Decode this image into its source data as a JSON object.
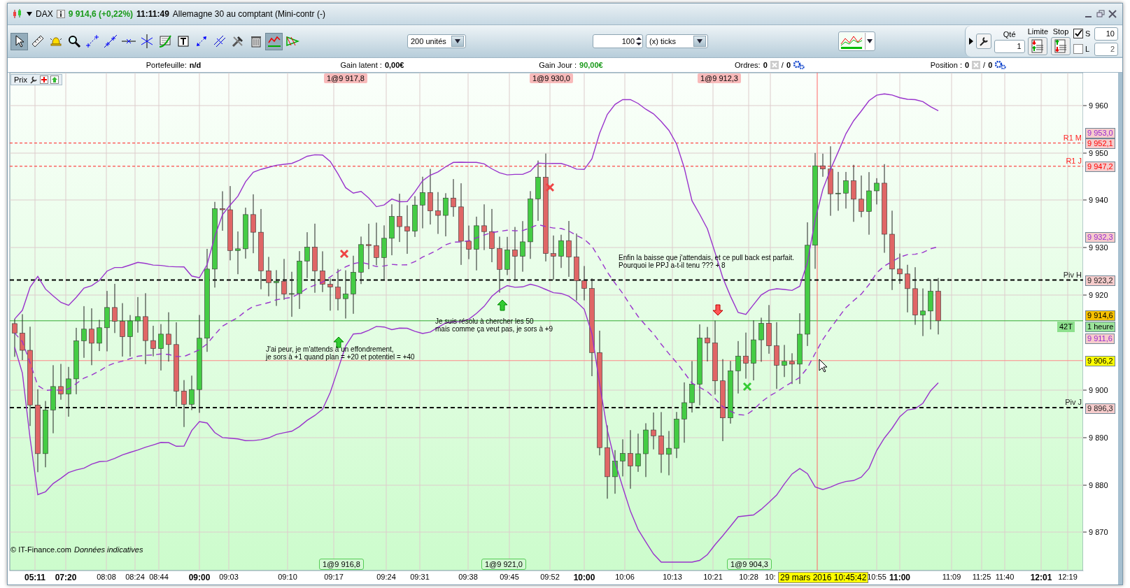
{
  "title_bar": {
    "symbol": "DAX",
    "quote": "9 914,6 (+0,22%)",
    "time": "11:11:49",
    "instrument": "Allemagne 30 au comptant (Mini-contr (-)"
  },
  "toolbar": {
    "tools": [
      {
        "kind": "pointer",
        "selected": true
      },
      {
        "kind": "ruler",
        "selected": false
      },
      {
        "kind": "alarm",
        "selected": false
      },
      {
        "kind": "zoom",
        "selected": false
      },
      {
        "kind": "segment",
        "selected": false
      },
      {
        "kind": "line",
        "selected": false
      },
      {
        "kind": "hline",
        "selected": false
      },
      {
        "kind": "vline",
        "selected": false
      },
      {
        "kind": "indicator",
        "selected": false
      },
      {
        "kind": "text",
        "selected": false
      },
      {
        "kind": "arrows",
        "selected": false
      },
      {
        "kind": "parallel",
        "selected": false
      },
      {
        "kind": "tools",
        "selected": false
      },
      {
        "kind": "trash",
        "selected": false
      },
      {
        "kind": "trend",
        "selected": true
      },
      {
        "kind": "triangle",
        "selected": false
      }
    ],
    "units_select": "200 unités",
    "tick_value": "100",
    "tick_select": "(x) ticks"
  },
  "order_panel": {
    "qty_label": "Qté",
    "qty": "1",
    "limit_label": "Limite",
    "stop_label": "Stop",
    "options": [
      {
        "label": "S",
        "checked": true,
        "value": "10"
      },
      {
        "label": "L",
        "checked": false,
        "value": "2"
      }
    ]
  },
  "info_bar": [
    {
      "kind": "text",
      "label": "Portefeuille:",
      "value": "n/d"
    },
    {
      "kind": "text",
      "label": "Gain latent :",
      "value": "0,00€"
    },
    {
      "kind": "gain",
      "label": "Gain Jour :",
      "value": "90,00€"
    },
    {
      "kind": "count",
      "label": "Ordres:",
      "value": "0",
      "separator": "/",
      "value_2": "0"
    },
    {
      "kind": "count",
      "label": "Position :",
      "value": "0",
      "separator": "/",
      "value_2": "0"
    }
  ],
  "chart": {
    "panel_label": "Prix",
    "price_ticks": [
      "9 960",
      "9 950",
      "9 940",
      "9 930",
      "9 920",
      "9 900",
      "9 890",
      "9 880",
      "9 870"
    ],
    "levels": [
      {
        "label": "R1 M",
        "kind": "resistance"
      },
      {
        "label": "R1 J",
        "kind": "resistance"
      },
      {
        "label": "Piv H",
        "kind": "pivot"
      },
      {
        "label": "Piv J",
        "kind": "pivot"
      }
    ],
    "price_tags": [
      {
        "text": "9 953,0",
        "kind": "indicator"
      },
      {
        "text": "9 952,1",
        "kind": "resistance"
      },
      {
        "text": "9 947,2",
        "kind": "resistance"
      },
      {
        "text": "9 932,3",
        "kind": "indicator"
      },
      {
        "text": "9 923,2",
        "kind": "pivot"
      },
      {
        "text": "9 914,6",
        "kind": "last"
      },
      {
        "text": "1 heure",
        "kind": "timeframe"
      },
      {
        "text": "9 911,6",
        "kind": "indicator"
      },
      {
        "text": "9 906,2",
        "kind": "order"
      },
      {
        "text": "9 896,3",
        "kind": "pivot"
      }
    ],
    "tick_tag": "42T",
    "top_orders": [
      "1@9 917,8",
      "1@9 930,0",
      "1@9 912,3"
    ],
    "bottom_orders": [
      "1@9 916,8",
      "1@9 921,0",
      "1@9 904,3"
    ],
    "notes": [
      "Enfin la baisse que j'attendais, et ce pull back est parfait.\nPourquoi le PPJ a-t-il tenu ??? + 8",
      "Je suis résolu à chercher les 50\nmais comme ça veut pas, je sors à +9",
      "J'ai peur, je m'attends à un effondrement,\nje sors à +1 quand plan = +20 et potentiel = +40"
    ],
    "copyright": "© IT-Finance.com",
    "disclaimer": "Données indicatives",
    "time_ticks": [
      {
        "label": "05:11",
        "major": true
      },
      {
        "label": "07:20",
        "major": true
      },
      {
        "label": "08:08",
        "major": false
      },
      {
        "label": "08:24",
        "major": false
      },
      {
        "label": "08:44",
        "major": false
      },
      {
        "label": "09:00",
        "major": true
      },
      {
        "label": "09:03",
        "major": false
      },
      {
        "label": "09:10",
        "major": false
      },
      {
        "label": "09:17",
        "major": false
      },
      {
        "label": "09:24",
        "major": false
      },
      {
        "label": "09:31",
        "major": false
      },
      {
        "label": "09:38",
        "major": false
      },
      {
        "label": "09:45",
        "major": false
      },
      {
        "label": "09:52",
        "major": false
      },
      {
        "label": "10:00",
        "major": true
      },
      {
        "label": "10:06",
        "major": false
      },
      {
        "label": "10:13",
        "major": false
      },
      {
        "label": "10:21",
        "major": false
      },
      {
        "label": "10:28",
        "major": false
      },
      {
        "label": "10:",
        "major": false
      },
      {
        "label": "10:55",
        "major": false
      },
      {
        "label": "11:00",
        "major": true
      },
      {
        "label": "11:09",
        "major": false
      },
      {
        "label": "11:25",
        "major": false
      },
      {
        "label": "11:40",
        "major": false
      },
      {
        "label": "12:01",
        "major": true
      },
      {
        "label": "12:19",
        "major": false
      }
    ],
    "cursor_date": "29 mars 2016 10:45:42"
  }
}
